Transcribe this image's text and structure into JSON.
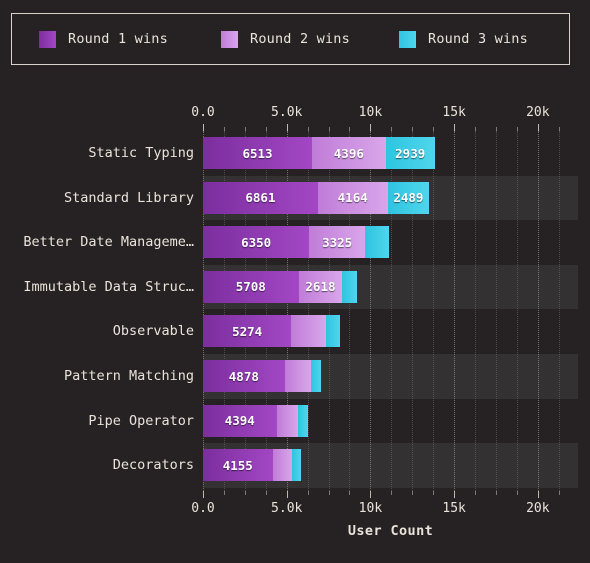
{
  "theme": {
    "background": "#262223",
    "band_color": "#333132",
    "text_color": "#e9e4da",
    "legend_border": "#d8d2c8",
    "grid_color": "#8f8a86"
  },
  "legend": {
    "items": [
      {
        "label": "Round 1 wins",
        "color": "#7b2e9e",
        "color_end": "#a347c4"
      },
      {
        "label": "Round 2 wins",
        "color": "#c07cd8",
        "color_end": "#d9a6ea"
      },
      {
        "label": "Round 3 wins",
        "color": "#2fc4e0",
        "color_end": "#4fd6ec"
      }
    ]
  },
  "chart_data": {
    "type": "bar",
    "orientation": "horizontal",
    "stacked": true,
    "title": "",
    "xlabel": "User Count",
    "ylabel": "",
    "xlim": [
      0,
      22400
    ],
    "grid": true,
    "legend_position": "top",
    "categories": [
      "Static Typing",
      "Standard Library",
      "Better Date Manageme…",
      "Immutable Data Struc…",
      "Observable",
      "Pattern Matching",
      "Pipe Operator",
      "Decorators"
    ],
    "series": [
      {
        "name": "Round 1 wins",
        "values": [
          6513,
          6861,
          6350,
          5708,
          5274,
          4878,
          4394,
          4155
        ]
      },
      {
        "name": "Round 2 wins",
        "values": [
          4396,
          4164,
          3325,
          2618,
          2100,
          1550,
          1300,
          1180
        ]
      },
      {
        "name": "Round 3 wins",
        "values": [
          2939,
          2489,
          1450,
          900,
          800,
          600,
          550,
          500
        ]
      }
    ],
    "bar_labels": [
      [
        "6513",
        "4396",
        "2939"
      ],
      [
        "6861",
        "4164",
        "2489"
      ],
      [
        "6350",
        "3325",
        ""
      ],
      [
        "5708",
        "2618",
        ""
      ],
      [
        "5274",
        "",
        ""
      ],
      [
        "4878",
        "",
        ""
      ],
      [
        "4394",
        "",
        ""
      ],
      [
        "4155",
        "",
        ""
      ]
    ],
    "xticks": [
      {
        "value": 0,
        "label": "0.0"
      },
      {
        "value": 5000,
        "label": "5.0k"
      },
      {
        "value": 10000,
        "label": "10k"
      },
      {
        "value": 15000,
        "label": "15k"
      },
      {
        "value": 20000,
        "label": "20k"
      }
    ],
    "xticks_minor": [
      1250,
      2500,
      3750,
      6250,
      7500,
      8750,
      11250,
      12500,
      13750,
      16250,
      17500,
      18750,
      21250
    ]
  }
}
